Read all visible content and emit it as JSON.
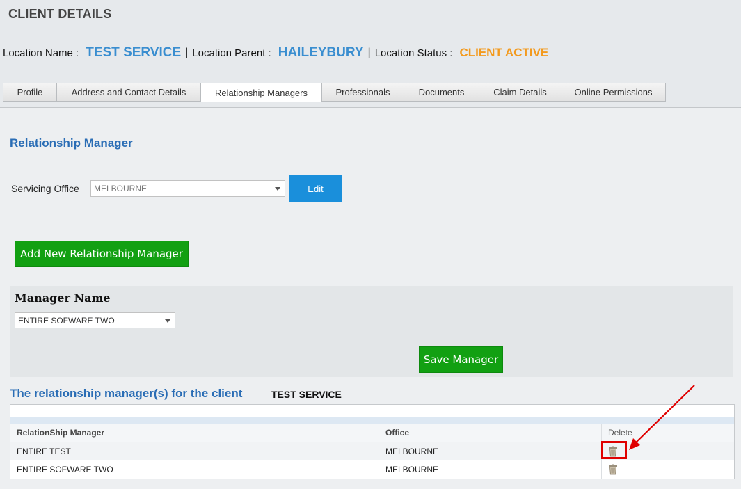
{
  "page": {
    "title": "CLIENT DETAILS"
  },
  "location": {
    "name_label": "Location Name :",
    "name_value": "TEST SERVICE",
    "parent_label": "Location Parent :",
    "parent_value": "HAILEYBURY",
    "status_label": "Location Status :",
    "status_value": "CLIENT ACTIVE",
    "separator": "|"
  },
  "tabs": [
    {
      "label": "Profile"
    },
    {
      "label": "Address and Contact Details"
    },
    {
      "label": "Relationship Managers",
      "active": true
    },
    {
      "label": "Professionals"
    },
    {
      "label": "Documents"
    },
    {
      "label": "Claim Details"
    },
    {
      "label": "Online Permissions"
    }
  ],
  "relationship_manager": {
    "section_title": "Relationship Manager",
    "servicing_office_label": "Servicing Office",
    "servicing_office_value": "MELBOURNE",
    "edit_label": "Edit",
    "add_button_label": "Add New Relationship Manager",
    "manager_name_label": "Manager Name",
    "manager_name_value": "ENTIRE SOFWARE TWO",
    "save_button_label": "Save Manager"
  },
  "managers_table": {
    "title": "The relationship manager(s) for the client",
    "client_name": "TEST SERVICE",
    "columns": [
      "RelationShip Manager",
      "Office",
      "Delete"
    ],
    "rows": [
      {
        "manager": "ENTIRE TEST",
        "office": "MELBOURNE",
        "delete_icon": "trash-icon"
      },
      {
        "manager": "ENTIRE SOFWARE TWO",
        "office": "MELBOURNE",
        "delete_icon": "trash-icon"
      }
    ]
  },
  "colors": {
    "accent_blue": "#3a8ed0",
    "status_orange": "#f39a1e",
    "button_green": "#12a012",
    "button_blue": "#1a8fdb",
    "annotation_red": "#e00000"
  }
}
